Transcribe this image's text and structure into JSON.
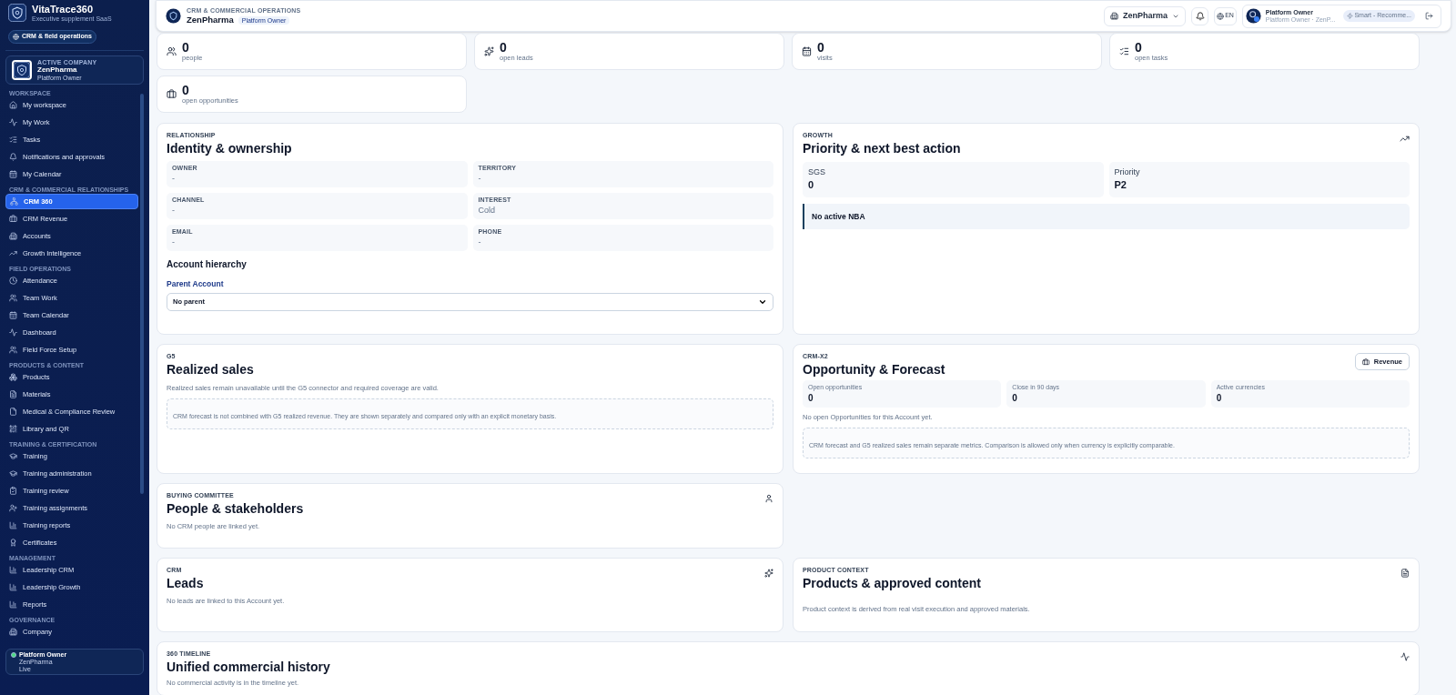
{
  "sidebar": {
    "brand": {
      "name": "VitaTrace360",
      "tagline": "Executive supplement SaaS",
      "mode_chip": "CRM & field operations"
    },
    "active_company": {
      "label": "ACTIVE COMPANY",
      "name": "ZenPharma",
      "role": "Platform Owner"
    },
    "sections": [
      {
        "title": "WORKSPACE",
        "items": [
          {
            "label": "My workspace",
            "selected": false
          },
          {
            "label": "My Work",
            "selected": false
          },
          {
            "label": "Tasks",
            "selected": false
          },
          {
            "label": "Notifications and approvals",
            "selected": false
          },
          {
            "label": "My Calendar",
            "selected": false
          }
        ]
      },
      {
        "title": "CRM & COMMERCIAL RELATIONSHIPS",
        "items": [
          {
            "label": "CRM 360",
            "selected": true
          },
          {
            "label": "CRM Revenue",
            "selected": false
          },
          {
            "label": "Accounts",
            "selected": false
          },
          {
            "label": "Growth Intelligence",
            "selected": false
          }
        ]
      },
      {
        "title": "FIELD OPERATIONS",
        "items": [
          {
            "label": "Attendance",
            "selected": false
          },
          {
            "label": "Team Work",
            "selected": false
          },
          {
            "label": "Team Calendar",
            "selected": false
          },
          {
            "label": "Dashboard",
            "selected": false
          },
          {
            "label": "Field Force Setup",
            "selected": false
          }
        ]
      },
      {
        "title": "PRODUCTS & CONTENT",
        "items": [
          {
            "label": "Products",
            "selected": false
          },
          {
            "label": "Materials",
            "selected": false
          },
          {
            "label": "Medical & Compliance Review",
            "selected": false
          },
          {
            "label": "Library and QR",
            "selected": false
          }
        ]
      },
      {
        "title": "TRAINING & CERTIFICATION",
        "items": [
          {
            "label": "Training",
            "selected": false
          },
          {
            "label": "Training administration",
            "selected": false
          },
          {
            "label": "Training review",
            "selected": false
          },
          {
            "label": "Training assignments",
            "selected": false
          },
          {
            "label": "Training reports",
            "selected": false
          },
          {
            "label": "Certificates",
            "selected": false
          }
        ]
      },
      {
        "title": "MANAGEMENT",
        "items": [
          {
            "label": "Leadership CRM",
            "selected": false
          },
          {
            "label": "Leadership Growth",
            "selected": false
          },
          {
            "label": "Reports",
            "selected": false
          }
        ]
      },
      {
        "title": "GOVERNANCE",
        "items": [
          {
            "label": "Company",
            "selected": false
          }
        ]
      }
    ],
    "footer": {
      "name": "Platform Owner",
      "company": "ZenPharma",
      "status": "Live"
    }
  },
  "header": {
    "eyebrow": "CRM & COMMERCIAL OPERATIONS",
    "title": "ZenPharma",
    "badge": "Platform Owner",
    "company_select": "ZenPharma",
    "language": "EN",
    "user": {
      "name": "Platform Owner",
      "subtitle": "Platform Owner · ZenP...",
      "chip": "Smart - Recomme..."
    }
  },
  "stats": [
    {
      "value": "0",
      "label": "people"
    },
    {
      "value": "0",
      "label": "open leads"
    },
    {
      "value": "0",
      "label": "visits"
    },
    {
      "value": "0",
      "label": "open tasks"
    },
    {
      "value": "0",
      "label": "open opportunities"
    }
  ],
  "identity": {
    "eyebrow": "RELATIONSHIP",
    "title": "Identity & ownership",
    "fields": [
      {
        "label": "OWNER",
        "value": "-"
      },
      {
        "label": "TERRITORY",
        "value": "-"
      },
      {
        "label": "CHANNEL",
        "value": "-"
      },
      {
        "label": "INTEREST",
        "value": "Cold"
      },
      {
        "label": "EMAIL",
        "value": "-"
      },
      {
        "label": "PHONE",
        "value": "-"
      }
    ],
    "hierarchy_title": "Account hierarchy",
    "parent_label": "Parent Account",
    "parent_value": "No parent"
  },
  "growth": {
    "eyebrow": "GROWTH",
    "title": "Priority & next best action",
    "metrics": [
      {
        "label": "SGS",
        "value": "0"
      },
      {
        "label": "Priority",
        "value": "P2"
      }
    ],
    "nba": "No active NBA"
  },
  "realized": {
    "eyebrow": "G5",
    "title": "Realized sales",
    "text": "Realized sales remain unavailable until the G5 connector and required coverage are valid.",
    "note": "CRM forecast is not combined with G5 realized revenue. They are shown separately and compared only with an explicit monetary basis."
  },
  "opportunity": {
    "eyebrow": "CRM-X2",
    "title": "Opportunity & Forecast",
    "button": "Revenue",
    "metrics": [
      {
        "label": "Open opportunities",
        "value": "0"
      },
      {
        "label": "Close in 90 days",
        "value": "0"
      },
      {
        "label": "Active currencies",
        "value": "0"
      }
    ],
    "text": "No open Opportunities for this Account yet.",
    "note": "CRM forecast and G5 realized sales remain separate metrics. Comparison is allowed only when currency is explicitly comparable."
  },
  "people": {
    "eyebrow": "BUYING COMMITTEE",
    "title": "People & stakeholders",
    "text": "No CRM people are linked yet."
  },
  "leads": {
    "eyebrow": "CRM",
    "title": "Leads",
    "text": "No leads are linked to this Account yet."
  },
  "products": {
    "eyebrow": "PRODUCT CONTEXT",
    "title": "Products & approved content",
    "text": "Product context is derived from real visit execution and approved materials."
  },
  "timeline": {
    "eyebrow": "360 TIMELINE",
    "title": "Unified commercial history",
    "text": "No commercial activity is in the timeline yet."
  }
}
